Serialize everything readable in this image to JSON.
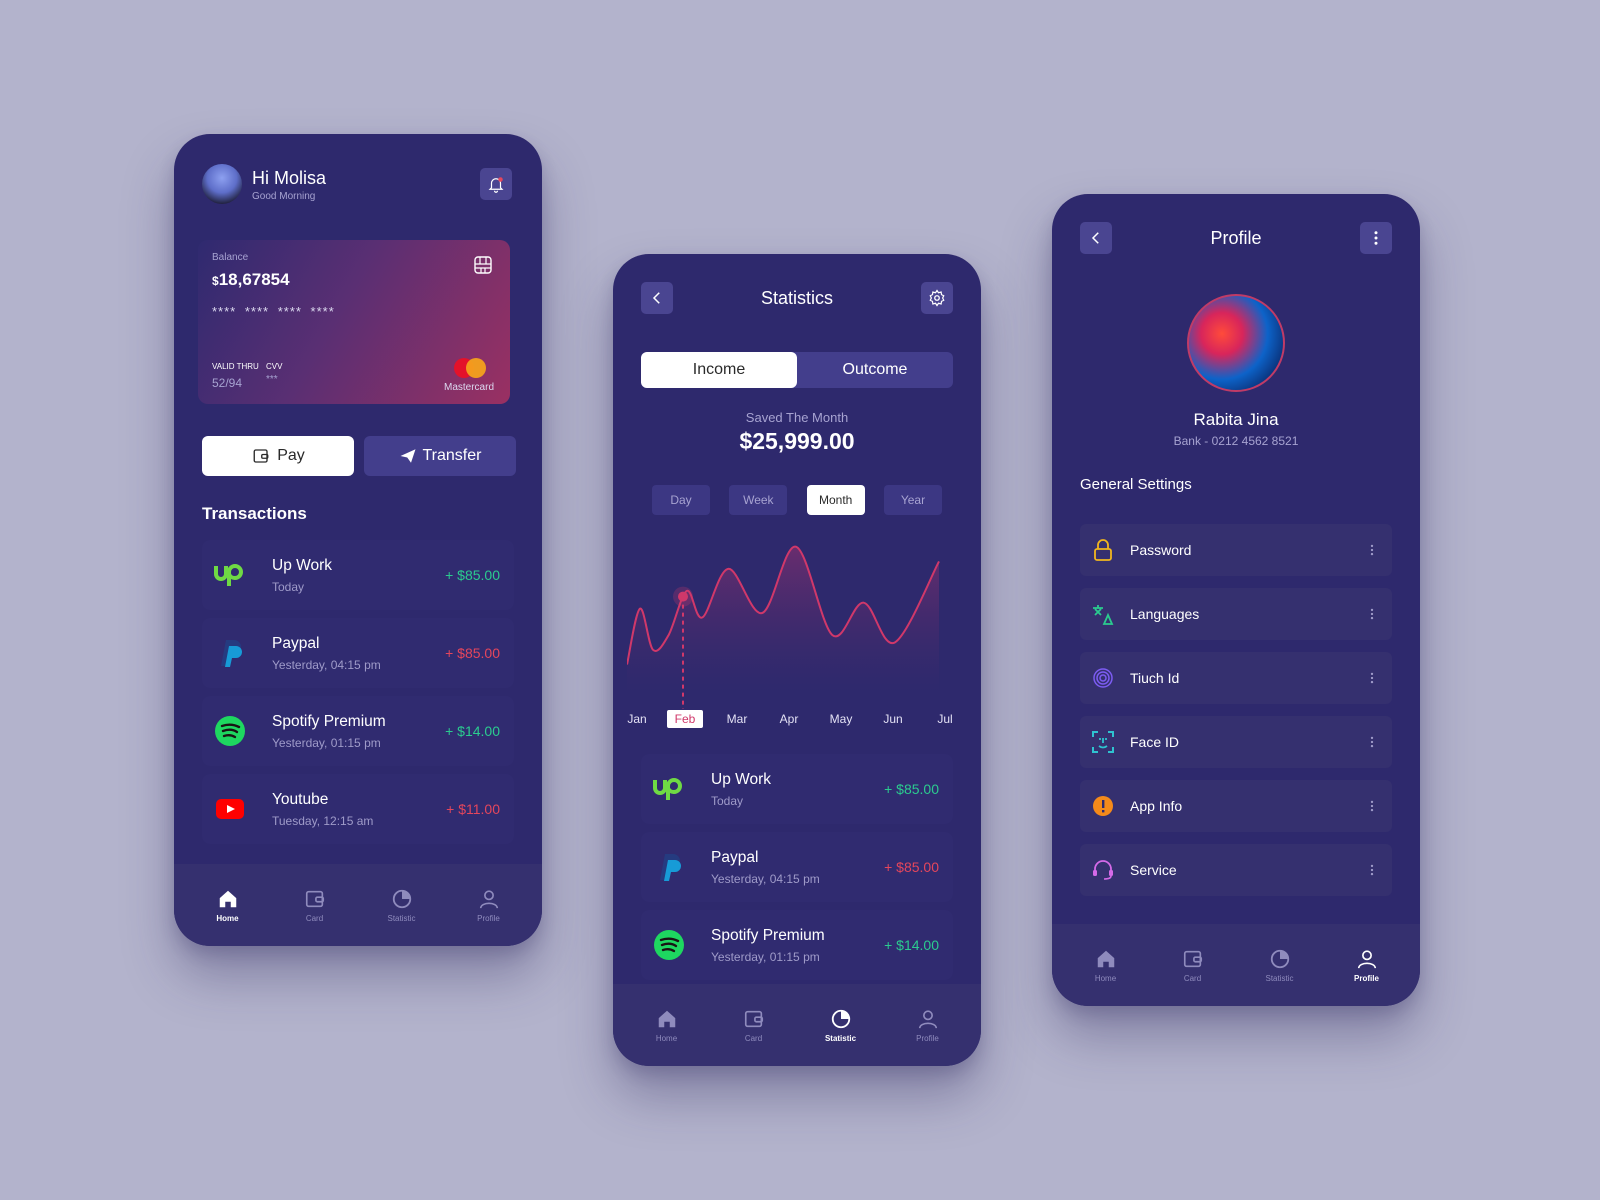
{
  "colors": {
    "background": "#b3b3cc",
    "phone": "#2e296d",
    "accent": "#e4465c",
    "positive": "#2bcb8f",
    "negative": "#e4465c"
  },
  "home": {
    "greeting": "Hi Molisa",
    "subgreeting": "Good Morning",
    "card": {
      "balance_label": "Balance",
      "currency": "$",
      "balance": "18,67854",
      "number_masked": "**** **** **** ****",
      "valid_label": "VALID THRU",
      "valid_value": "52/94",
      "cvv_label": "CVV",
      "cvv_value": "***",
      "brand": "Mastercard"
    },
    "pay_label": "Pay",
    "transfer_label": "Transfer",
    "transactions_title": "Transactions",
    "transactions": [
      {
        "name": "Up Work",
        "time": "Today",
        "amount": "+ $85.00",
        "type": "positive",
        "icon": "upwork-logo"
      },
      {
        "name": "Paypal",
        "time": "Yesterday, 04:15 pm",
        "amount": "+ $85.00",
        "type": "negative",
        "icon": "paypal-logo"
      },
      {
        "name": "Spotify Premium",
        "time": "Yesterday, 01:15 pm",
        "amount": "+ $14.00",
        "type": "positive",
        "icon": "spotify-logo"
      },
      {
        "name": "Youtube",
        "time": "Tuesday, 12:15 am",
        "amount": "+ $11.00",
        "type": "negative",
        "icon": "youtube-logo"
      }
    ]
  },
  "nav": {
    "items": [
      {
        "label": "Home",
        "icon": "home-icon"
      },
      {
        "label": "Card",
        "icon": "wallet-icon"
      },
      {
        "label": "Statistic",
        "icon": "pie-chart-icon"
      },
      {
        "label": "Profile",
        "icon": "user-icon"
      }
    ]
  },
  "stats": {
    "title": "Statistics",
    "tabs": [
      "Income",
      "Outcome"
    ],
    "active_tab": "Income",
    "saved_label": "Saved The Month",
    "saved_amount": "$25,999.00",
    "periods": [
      "Day",
      "Week",
      "Month",
      "Year"
    ],
    "active_period": "Month",
    "transactions": [
      {
        "name": "Up Work",
        "time": "Today",
        "amount": "+ $85.00",
        "type": "positive",
        "icon": "upwork-logo"
      },
      {
        "name": "Paypal",
        "time": "Yesterday, 04:15 pm",
        "amount": "+ $85.00",
        "type": "negative",
        "icon": "paypal-logo"
      },
      {
        "name": "Spotify Premium",
        "time": "Yesterday, 01:15 pm",
        "amount": "+ $14.00",
        "type": "positive",
        "icon": "spotify-logo"
      }
    ]
  },
  "chart_data": {
    "type": "area",
    "title": "",
    "categories": [
      "Jan",
      "Feb",
      "Mar",
      "Apr",
      "May",
      "Jun",
      "Jul"
    ],
    "highlighted": "Feb",
    "x": [
      0,
      0.25,
      0.5,
      0.8,
      1.15,
      1.45,
      1.95,
      2.6,
      3.25,
      3.95,
      4.55,
      5.15,
      6.0
    ],
    "values": [
      20,
      58,
      30,
      40,
      70,
      52,
      85,
      55,
      100,
      40,
      62,
      35,
      90
    ],
    "ylim": [
      0,
      110
    ],
    "xlabel": "",
    "ylabel": "",
    "grid": false
  },
  "profile": {
    "title": "Profile",
    "name": "Rabita Jina",
    "bank": "Bank - 0212 4562 8521",
    "settings_title": "General Settings",
    "settings": [
      {
        "label": "Password",
        "icon": "lock-icon",
        "color": "#f2b61e"
      },
      {
        "label": "Languages",
        "icon": "translate-icon",
        "color": "#2bcb8f"
      },
      {
        "label": "Tiuch Id",
        "icon": "fingerprint-icon",
        "color": "#7c5cf2"
      },
      {
        "label": "Face ID",
        "icon": "face-id-icon",
        "color": "#2fc3d0"
      },
      {
        "label": "App Info",
        "icon": "info-icon",
        "color": "#f58a1a"
      },
      {
        "label": "Service",
        "icon": "headset-icon",
        "color": "#d46ae8"
      }
    ]
  }
}
